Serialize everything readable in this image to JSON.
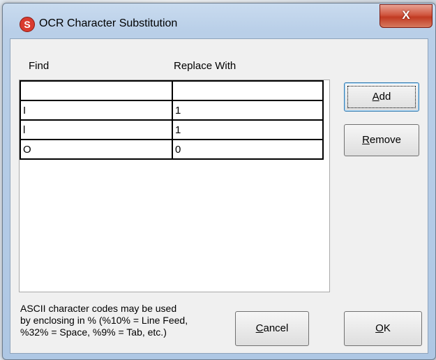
{
  "window": {
    "title": "OCR Character Substitution",
    "close_label": "X",
    "icon_letter": "S"
  },
  "headers": {
    "find": "Find",
    "replace": "Replace With"
  },
  "rows": [
    {
      "find": "",
      "replace": ""
    },
    {
      "find": "I",
      "replace": "1"
    },
    {
      "find": "l",
      "replace": "1"
    },
    {
      "find": "O",
      "replace": "0"
    }
  ],
  "buttons": {
    "add": {
      "accel": "A",
      "rest": "dd"
    },
    "remove": {
      "accel": "R",
      "rest": "emove"
    },
    "cancel": {
      "accel": "C",
      "rest": "ancel"
    },
    "ok": {
      "accel": "O",
      "rest": "K"
    }
  },
  "note": {
    "lines": [
      "ASCII character codes may be used",
      "by enclosing in % (%10% = Line Feed,",
      "%32% = Space, %9% = Tab, etc.)"
    ]
  },
  "colors": {
    "title_bar": "#b9cfe8",
    "close_button": "#c13a22",
    "client_background": "#f0f0f0"
  }
}
